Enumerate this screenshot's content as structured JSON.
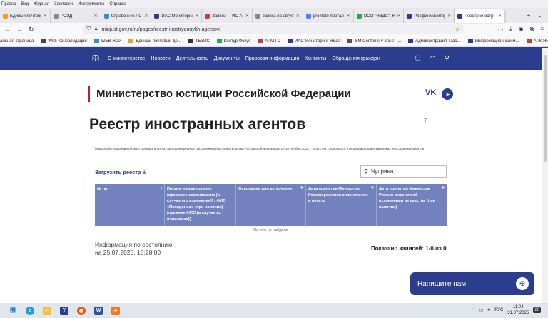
{
  "browser": {
    "menu": [
      "Правка",
      "Вид",
      "Журнал",
      "Закладки",
      "Инструменты",
      "Справка"
    ],
    "tabs": [
      {
        "label": "Единый почтовый",
        "color": "#f0a020",
        "active": false
      },
      {
        "label": "РСЭД",
        "color": "#888888",
        "active": false
      },
      {
        "label": "Справочник РС",
        "color": "#2b8fd6",
        "active": false
      },
      {
        "label": "ИАС Мониторинг",
        "color": "#2b3d8c",
        "active": false
      },
      {
        "label": "Заявки - ГИС А",
        "color": "#c04040",
        "active": false
      },
      {
        "label": "заявка на август 25",
        "color": "#888888",
        "active": false
      },
      {
        "label": "promote портал",
        "color": "#4285f4",
        "active": false
      },
      {
        "label": "ООО \"НВДС\", Н",
        "color": "#2aa84a",
        "active": false
      },
      {
        "label": "Росфинмонитори",
        "color": "#2b3d8c",
        "active": false
      },
      {
        "label": "Реестр иностр",
        "color": "#2b3d8c",
        "active": true
      }
    ],
    "url": "minjust.gov.ru/ru/pages/reestr-inostryannykh-agentov/",
    "bookmarks": [
      {
        "label": "альная страница",
        "color": "#888888"
      },
      {
        "label": "Web-Консолидация",
        "color": "#444444"
      },
      {
        "label": "WEB-НСИ",
        "color": "#2b8fd6"
      },
      {
        "label": "Единый почтовый до...",
        "color": "#f0a020"
      },
      {
        "label": "ТЕЗИС",
        "color": "#333333"
      },
      {
        "label": "Контур.Фокус",
        "color": "#2aa84a"
      },
      {
        "label": "АРМ ГС",
        "color": "#c04040"
      },
      {
        "label": "ИАС Мониторинг Ямал",
        "color": "#2b3d8c"
      },
      {
        "label": "SM:Contents v 2.3.0 - ...",
        "color": "#555555"
      },
      {
        "label": "Администрация Тазо...",
        "color": "#2b3d8c"
      },
      {
        "label": "Информационный м...",
        "color": "#2b3d8c"
      },
      {
        "label": "АПК ЯНАО",
        "color": "#c04040"
      }
    ]
  },
  "site": {
    "nav": [
      "О министерстве",
      "Новости",
      "Деятельность",
      "Документы",
      "Правовая информация",
      "Контакты",
      "Обращения граждан"
    ],
    "ministry_name": "Министерство юстиции Российской Федерации",
    "page_title": "Реестр иностранных агентов",
    "description": "Подробные сведения об иностранных агентах, предусмотренные распоряжением Правительства Российской Федерации от 10 ноября 2022 г. N 3417-р, содержатся в индивидуальных карточках иностранных агентов",
    "download_label": "Загрузить реестр",
    "search_value": "Чуприна",
    "table": {
      "headers": [
        "№ п/п",
        "Полное наименование (прежнее наименование (в случае его изменения)) / ФИО «Псевдоним» (при наличии) (прежние ФИО (в случае их изменения))",
        "Основания для включения",
        "Дата принятия Минюстом России решения о включении в реестр",
        "Дата принятия Минюстом России решения об исключении из реестра (при наличии)"
      ],
      "empty_text": "Ничего не найдено"
    },
    "info_line1": "Информация по состоянию",
    "info_line2": "на 25.07.2025, 18:28:00",
    "records_text": "Показано записей: 1-0 из 0",
    "chat_label": "Напишите нам!"
  },
  "taskbar": {
    "lang": "РУС",
    "time": "11:04",
    "date": "31.07.2025",
    "notifications": "20"
  }
}
